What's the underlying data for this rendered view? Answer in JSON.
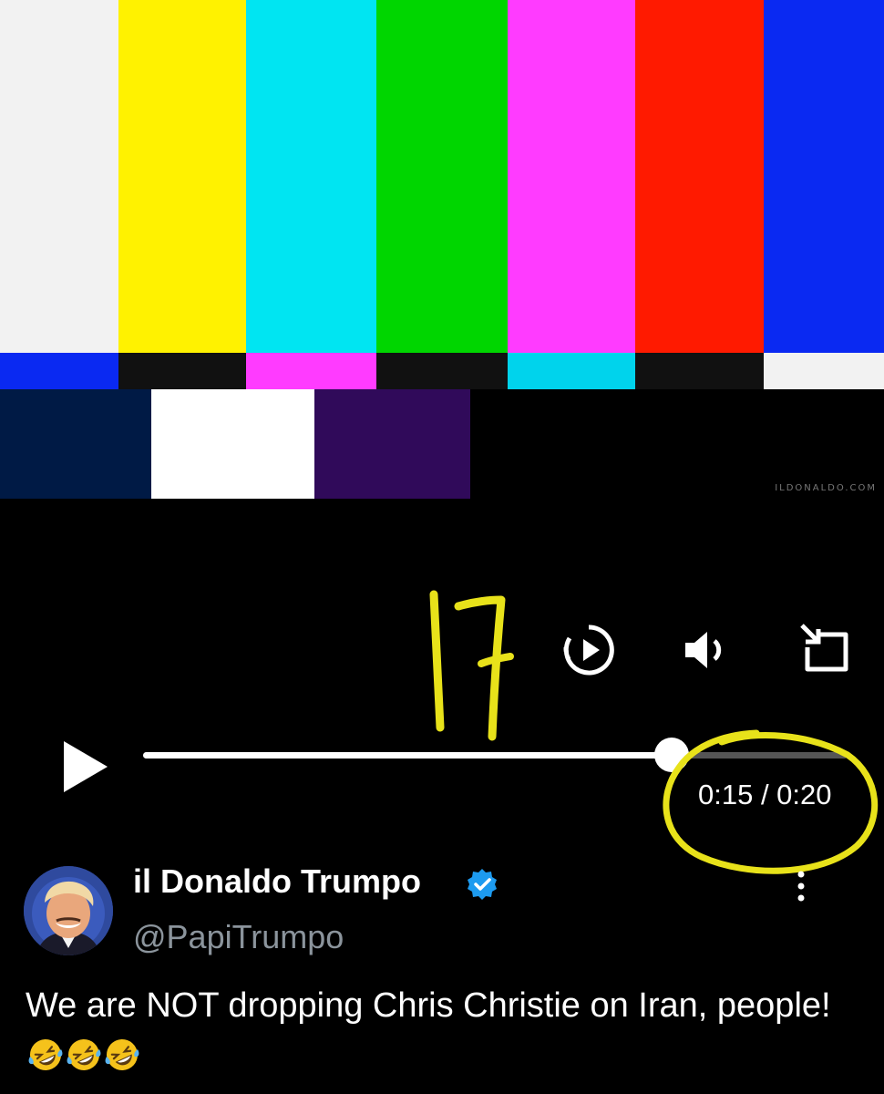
{
  "video": {
    "top_bars": [
      "#f2f2f2",
      "#fff200",
      "#00e5f2",
      "#00d600",
      "#ff3bff",
      "#ff1a00",
      "#0a29f2"
    ],
    "mid_bars": [
      "#0a29f2",
      "#111111",
      "#ff3bff",
      "#111111",
      "#00d3ec",
      "#111111",
      "#f2f2f2"
    ],
    "low_bars": [
      "#001a45",
      "#ffffff",
      "#300a5a",
      "#000000"
    ],
    "watermark": "ILDONALDO.COM"
  },
  "player": {
    "play_icon": "play-icon",
    "replay_icon": "replay-icon",
    "volume_icon": "volume-icon",
    "pip_icon": "picture-in-picture-icon",
    "progress": 0.75,
    "time_display": "0:15 / 0:20"
  },
  "annotation": {
    "handwritten_number": "17",
    "color": "#e8e21a"
  },
  "tweet": {
    "display_name": "il Donaldo Trumpo",
    "verified": true,
    "handle": "@PapiTrumpo",
    "text": "We are NOT dropping Chris Christie on Iran, people!",
    "emoji_count": 3,
    "emoji_name": "rolling-on-the-floor-laughing",
    "accent_color": "#1d9bf0"
  }
}
